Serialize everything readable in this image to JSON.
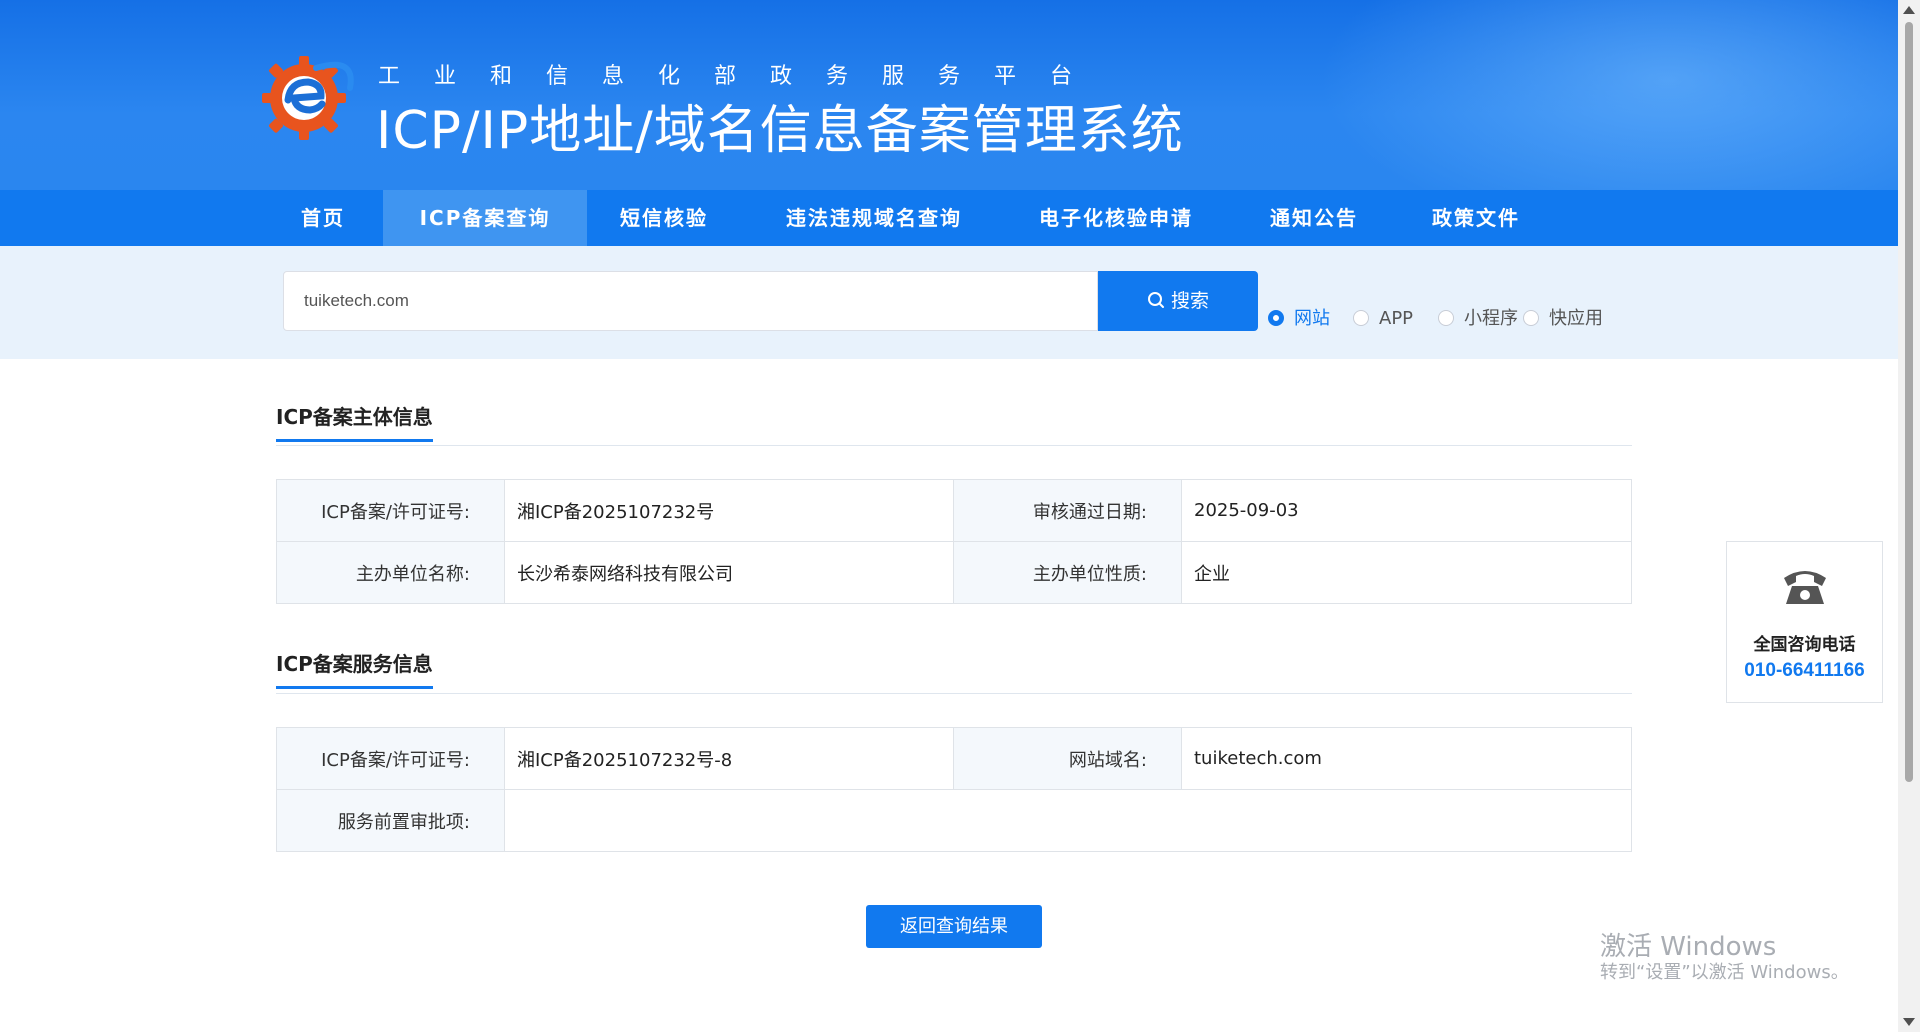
{
  "header": {
    "subtitle": "工业和信息化部政务服务平台",
    "title": "ICP/IP地址/域名信息备案管理系统"
  },
  "nav": {
    "items": [
      {
        "label": "首页"
      },
      {
        "label": "ICP备案查询",
        "active": true
      },
      {
        "label": "短信核验"
      },
      {
        "label": "违法违规域名查询"
      },
      {
        "label": "电子化核验申请"
      },
      {
        "label": "通知公告"
      },
      {
        "label": "政策文件"
      }
    ]
  },
  "search": {
    "value": "tuiketech.com",
    "button_label": "搜索",
    "options": [
      {
        "label": "网站",
        "checked": true
      },
      {
        "label": "APP",
        "checked": false
      },
      {
        "label": "小程序",
        "checked": false
      },
      {
        "label": "快应用",
        "checked": false
      }
    ]
  },
  "subject_section": {
    "title": "ICP备案主体信息",
    "rows": [
      {
        "label1": "ICP备案/许可证号:",
        "value1": "湘ICP备2025107232号",
        "label2": "审核通过日期:",
        "value2": "2025-09-03"
      },
      {
        "label1": "主办单位名称:",
        "value1": "长沙希泰网络科技有限公司",
        "label2": "主办单位性质:",
        "value2": "企业"
      }
    ]
  },
  "service_section": {
    "title": "ICP备案服务信息",
    "license_label": "ICP备案/许可证号:",
    "license_value": "湘ICP备2025107232号-8",
    "domain_label": "网站域名:",
    "domain_value": "tuiketech.com",
    "approval_label": "服务前置审批项:",
    "approval_value": ""
  },
  "back_button": "返回查询结果",
  "consult": {
    "icon": "telephone-icon",
    "label": "全国咨询电话",
    "number": "010-66411166"
  },
  "watermark": {
    "line1": "激活 Windows",
    "line2": "转到“设置”以激活 Windows。"
  },
  "colors": {
    "primary": "#1179ef",
    "header_bg": "#1570e6",
    "search_band": "#e8f2fc",
    "label_bg": "#f4f8fc"
  }
}
